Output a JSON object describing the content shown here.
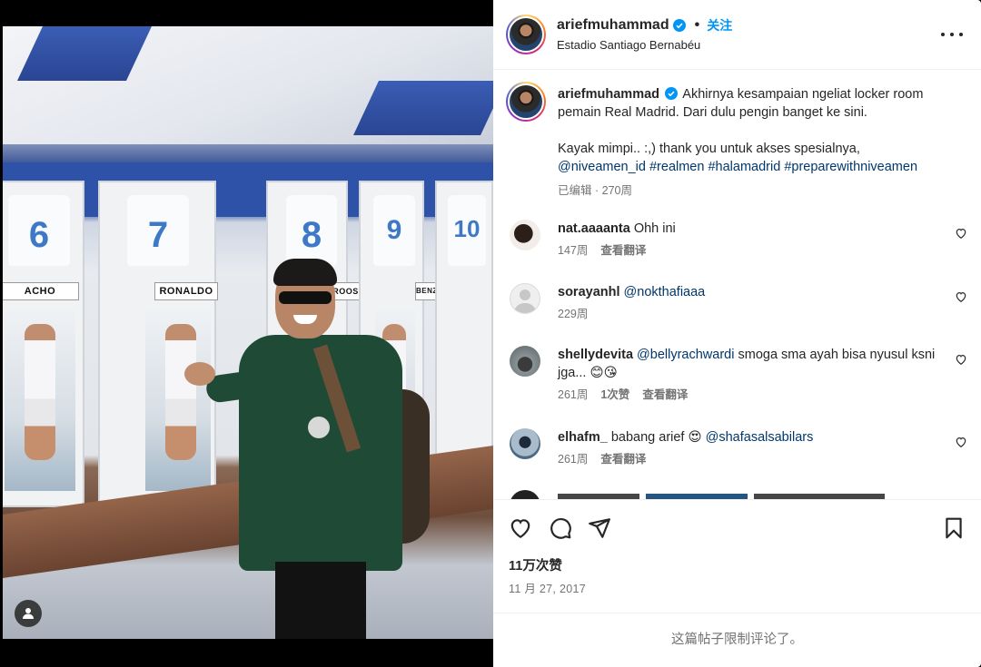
{
  "photo": {
    "jersey_numbers": [
      "6",
      "7",
      "8",
      "9",
      "10"
    ],
    "nameplates": [
      "ACHO",
      "RONALDO",
      "KROOS",
      "BENZEMA"
    ],
    "jersey_names": [
      "NACHO",
      "RONALDO"
    ],
    "user_tag_icon": "person-icon"
  },
  "header": {
    "username": "ariefmuhammad",
    "verified_icon": "verified-badge-icon",
    "separator": "•",
    "follow_label": "关注",
    "location": "Estadio Santiago Bernabéu",
    "more_icon": "more-options-icon"
  },
  "caption": {
    "username": "ariefmuhammad",
    "line1": "Akhirnya kesampaian ngeliat locker room pemain Real Madrid. Dari dulu pengin banget ke sini.",
    "line2": "Kayak mimpi.. :,) thank you untuk akses spesialnya,",
    "tags": [
      "@niveamen_id",
      "#realmen",
      "#halamadrid",
      "#preparewithniveamen"
    ],
    "edited": "已编辑",
    "meta_sep": "·",
    "age": "270周"
  },
  "comments": [
    {
      "username": "nat.aaaanta",
      "text": "Ohh ini",
      "mention": "",
      "age": "147周",
      "likes": "",
      "translate": "查看翻译"
    },
    {
      "username": "sorayanhl",
      "text": "",
      "mention": "@nokthafiaaa",
      "age": "229周",
      "likes": "",
      "translate": ""
    },
    {
      "username": "shellydevita",
      "mention": "@bellyrachwardi",
      "text": "smoga sma ayah bisa nyusul ksni jga... 😊😘",
      "age": "261周",
      "likes": "1次赞",
      "translate": "查看翻译"
    },
    {
      "username": "elhafm_",
      "text": "babang arief 😍",
      "mention": "@shafasalsabilars",
      "age": "261周",
      "likes": "",
      "translate": "查看翻译"
    }
  ],
  "actions": {
    "like_icon": "heart-icon",
    "comment_icon": "comment-icon",
    "share_icon": "share-icon",
    "save_icon": "bookmark-icon",
    "likes_count": "11万次赞",
    "date": "11 月 27, 2017"
  },
  "footer": {
    "comments_limited": "这篇帖子限制评论了。"
  },
  "colors": {
    "link": "#00376b",
    "follow": "#0095f6",
    "muted": "#737373",
    "verified": "#0095f6"
  }
}
